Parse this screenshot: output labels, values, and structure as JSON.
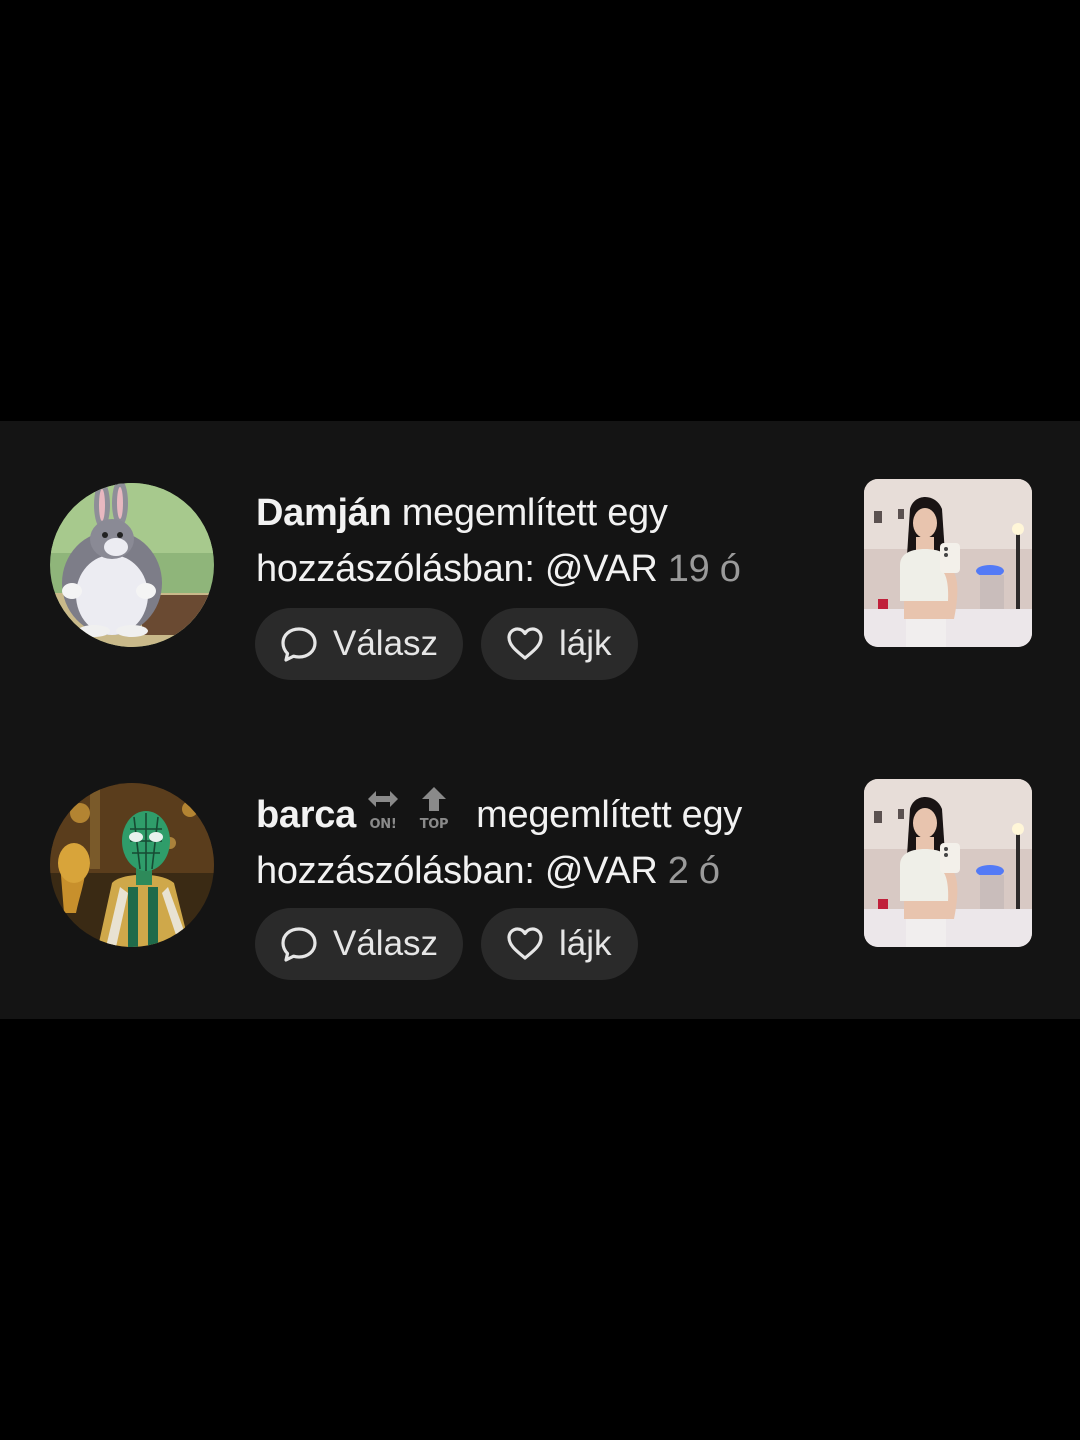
{
  "notifications": [
    {
      "username": "Damján",
      "action": " megemlített egy hozzászólásban: @VAR ",
      "time": "19 ó",
      "reply_label": "Válasz",
      "like_label": "lájk",
      "avatar_icon": "chubby-bunny-avatar",
      "thumbnail_icon": "mirror-selfie-thumbnail"
    },
    {
      "username": "barca",
      "badges": [
        "ON!",
        "TOP"
      ],
      "action": " megemlített egy hozzászólásban: @VAR ",
      "time": "2 ó",
      "reply_label": "Válasz",
      "like_label": "lájk",
      "avatar_icon": "masked-figure-avatar",
      "thumbnail_icon": "mirror-selfie-thumbnail"
    }
  ],
  "colors": {
    "background": "#000000",
    "panel": "#141414",
    "pill": "#2a2a2a",
    "text": "#f2f2f2",
    "muted": "#9a9a9a"
  }
}
